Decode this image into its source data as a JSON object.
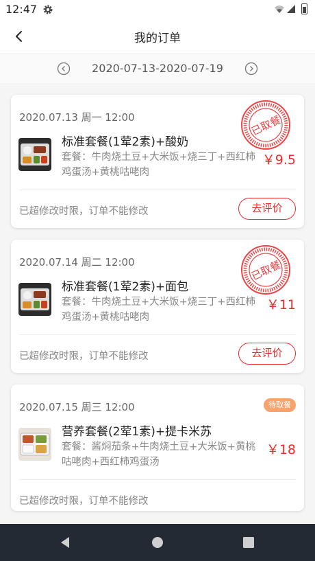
{
  "status_bar": {
    "time": "12:47"
  },
  "header": {
    "title": "我的订单",
    "back_icon": "back-arrow-icon"
  },
  "date_range": {
    "label": "2020-07-13-2020-07-19"
  },
  "colors": {
    "accent": "#ee2a2a",
    "badge": "#f7a36b",
    "nav_bg": "#232a33"
  },
  "orders": [
    {
      "date": "2020.07.13 周一 12:00",
      "name": "标准套餐(1荤2素)+酸奶",
      "desc": "套餐：牛肉烧土豆+大米饭+烧三丁+西红柿鸡蛋汤+黄桃咕咾肉",
      "price": "￥9.5",
      "stamp": "已取餐",
      "note": "已超修改时限，订单不能修改",
      "action": "去评价"
    },
    {
      "date": "2020.07.14 周二 12:00",
      "name": "标准套餐(1荤2素)+面包",
      "desc": "套餐：牛肉烧土豆+大米饭+烧三丁+西红柿鸡蛋汤+黄桃咕咾肉",
      "price": "￥11",
      "stamp": "已取餐",
      "note": "已超修改时限，订单不能修改",
      "action": "去评价"
    },
    {
      "date": "2020.07.15 周三 12:00",
      "name": "营养套餐(2荤1素)+提卡米苏",
      "desc": "套餐：酱焖茄条+牛肉烧土豆+大米饭+黄桃咕咾肉+西红柿鸡蛋汤",
      "price": "￥18",
      "badge": "待取餐",
      "note": "已超修改时限，订单不能修改"
    }
  ]
}
